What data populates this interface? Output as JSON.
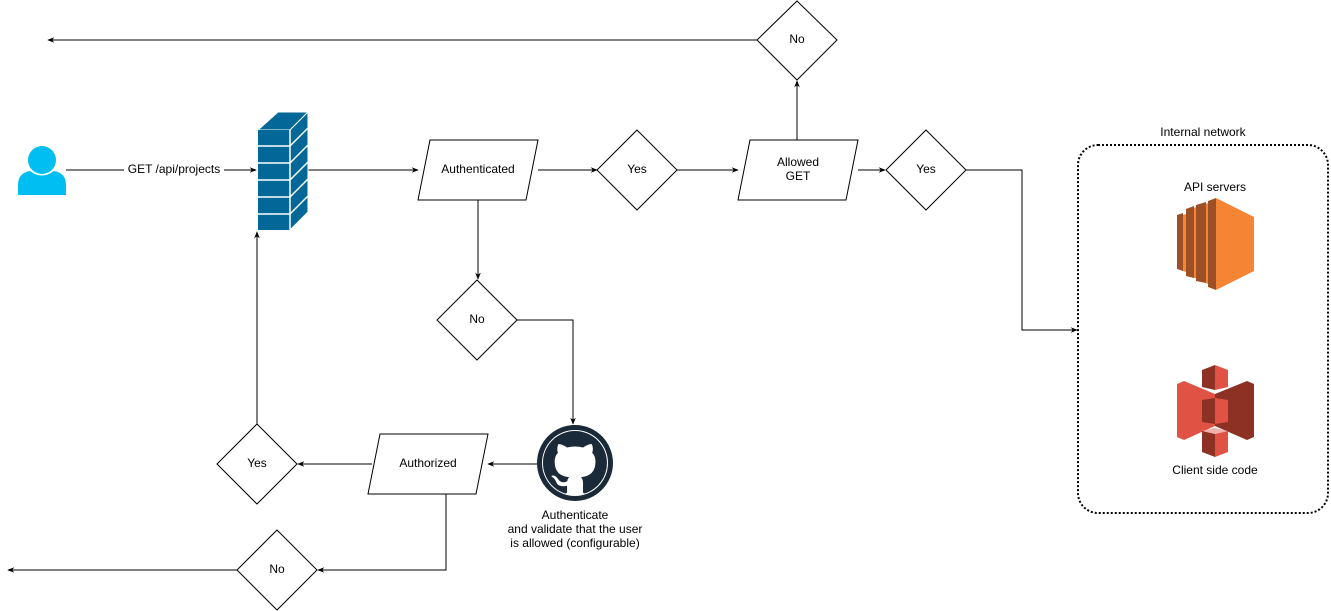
{
  "nodes": {
    "request_label": "GET /api/projects",
    "authenticated": "Authenticated",
    "auth_yes": "Yes",
    "auth_no": "No",
    "allowed_get": [
      "Allowed",
      "GET"
    ],
    "allowed_yes": "Yes",
    "allowed_no": "No",
    "github_caption": [
      "Authenticate",
      "and validate that the user",
      "is allowed (configurable)"
    ],
    "authorized": "Authorized",
    "authorized_yes": "Yes",
    "authorized_no": "No"
  },
  "internal_network": {
    "title": "Internal network",
    "api_servers": "API servers",
    "client_code": "Client side code"
  },
  "icons": {
    "user": "user-icon",
    "firewall": "firewall-icon",
    "github": "github-icon",
    "ec2": "aws-ec2-icon",
    "s3": "aws-s3-icon"
  },
  "colors": {
    "user": "#00bef2",
    "firewall": "#036897",
    "ec2": "#f58534",
    "s3": "#e05243",
    "github": "#1b2a38"
  }
}
